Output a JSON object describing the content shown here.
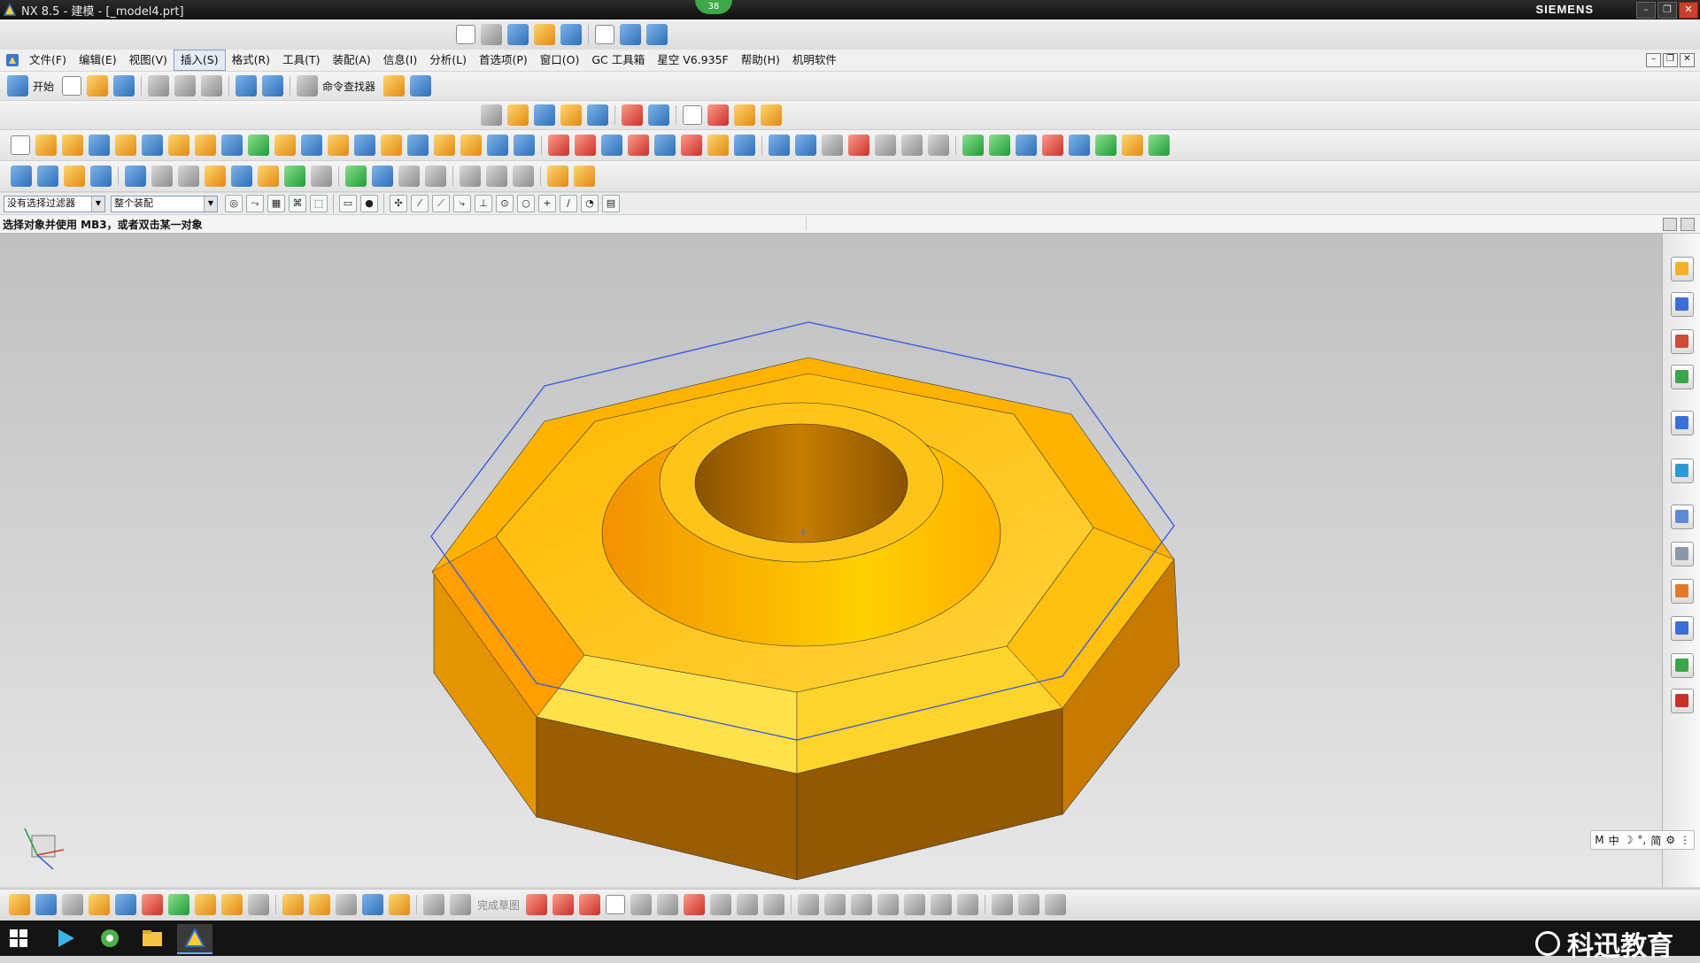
{
  "window": {
    "title": "NX 8.5 - 建模 - [_model4.prt]",
    "brand": "SIEMENS",
    "notification_count": "38",
    "min_glyph": "–",
    "restore_glyph": "❐",
    "close_glyph": "✕"
  },
  "menu": {
    "items": [
      "文件(F)",
      "编辑(E)",
      "视图(V)",
      "插入(S)",
      "格式(R)",
      "工具(T)",
      "装配(A)",
      "信息(I)",
      "分析(L)",
      "首选项(P)",
      "窗口(O)",
      "GC 工具箱",
      "星空 V6.935F",
      "帮助(H)",
      "机明软件"
    ],
    "active_index": 3
  },
  "standard_toolbar": {
    "start_label": "开始",
    "command_finder_label": "命令查找器"
  },
  "selection_bar": {
    "filter_value": "没有选择过滤器",
    "scope_value": "整个装配"
  },
  "cue_line": "选择对象并使用 MB3，或者双击某一对象",
  "sketch_toolbar": {
    "finish_sketch_label": "完成草图"
  },
  "ime_bar": {
    "items": [
      "M",
      "中",
      "☽",
      "°,",
      "简",
      "⚙",
      "⋮"
    ]
  },
  "watermark": "科迅教育",
  "model": {
    "body_color": "#f4b200",
    "shadow_color": "#9a5e00",
    "sketch_curve_color": "#3d5cdc"
  }
}
